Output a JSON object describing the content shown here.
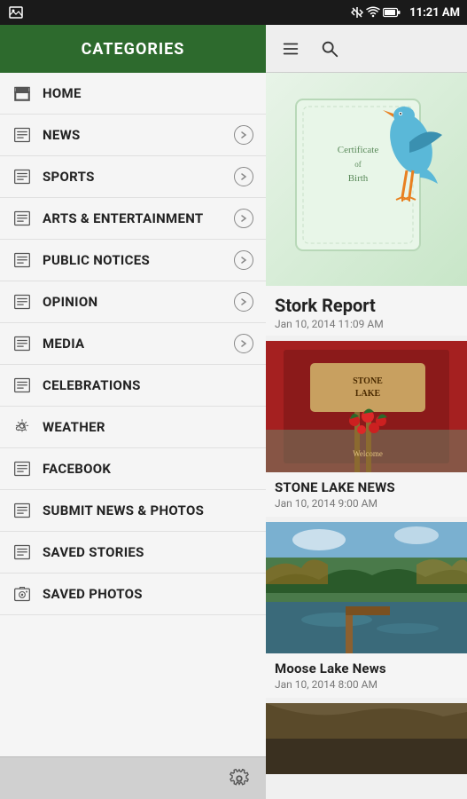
{
  "statusBar": {
    "time": "11:21 AM",
    "icons": [
      "mute",
      "wifi",
      "battery"
    ]
  },
  "sidebar": {
    "header": "CATEGORIES",
    "items": [
      {
        "id": "home",
        "label": "HOME",
        "hasArrow": false,
        "iconType": "newspaper"
      },
      {
        "id": "news",
        "label": "NEWS",
        "hasArrow": true,
        "iconType": "newspaper"
      },
      {
        "id": "sports",
        "label": "SPORTS",
        "hasArrow": true,
        "iconType": "newspaper"
      },
      {
        "id": "arts",
        "label": "ARTS & ENTERTAINMENT",
        "hasArrow": true,
        "iconType": "newspaper"
      },
      {
        "id": "public-notices",
        "label": "PUBLIC NOTICES",
        "hasArrow": true,
        "iconType": "newspaper"
      },
      {
        "id": "opinion",
        "label": "OPINION",
        "hasArrow": true,
        "iconType": "newspaper"
      },
      {
        "id": "media",
        "label": "MEDIA",
        "hasArrow": true,
        "iconType": "newspaper"
      },
      {
        "id": "celebrations",
        "label": "CELEBRATIONS",
        "hasArrow": false,
        "iconType": "newspaper"
      },
      {
        "id": "weather",
        "label": "WEATHER",
        "hasArrow": false,
        "iconType": "weather"
      },
      {
        "id": "facebook",
        "label": "FACEBOOK",
        "hasArrow": false,
        "iconType": "newspaper"
      },
      {
        "id": "submit-news",
        "label": "SUBMIT NEWS & PHOTOS",
        "hasArrow": false,
        "iconType": "newspaper"
      },
      {
        "id": "saved-stories",
        "label": "SAVED STORIES",
        "hasArrow": false,
        "iconType": "newspaper"
      },
      {
        "id": "saved-photos",
        "label": "SAVED PHOTOS",
        "hasArrow": false,
        "iconType": "camera"
      }
    ],
    "footerGear": "⚙"
  },
  "contentPanel": {
    "storkReport": {
      "title": "Stork Report",
      "date": "Jan 10, 2014 11:09 AM"
    },
    "newsItems": [
      {
        "id": "stone-lake",
        "title": "STONE LAKE NEWS",
        "date": "Jan 10, 2014 9:00 AM",
        "imageType": "stone-lake"
      },
      {
        "id": "moose-lake",
        "title": "Moose Lake News",
        "date": "Jan 10, 2014 8:00 AM",
        "imageType": "moose-lake"
      }
    ]
  }
}
